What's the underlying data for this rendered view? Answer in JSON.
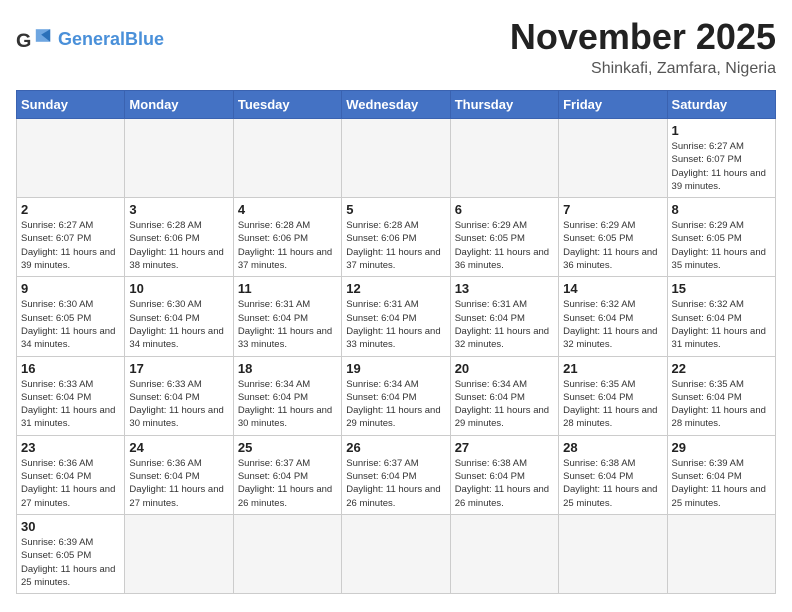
{
  "logo": {
    "general": "General",
    "blue": "Blue"
  },
  "header": {
    "month": "November 2025",
    "location": "Shinkafi, Zamfara, Nigeria"
  },
  "weekdays": [
    "Sunday",
    "Monday",
    "Tuesday",
    "Wednesday",
    "Thursday",
    "Friday",
    "Saturday"
  ],
  "days": {
    "1": {
      "sunrise": "6:27 AM",
      "sunset": "6:07 PM",
      "daylight": "11 hours and 39 minutes."
    },
    "2": {
      "sunrise": "6:27 AM",
      "sunset": "6:07 PM",
      "daylight": "11 hours and 39 minutes."
    },
    "3": {
      "sunrise": "6:28 AM",
      "sunset": "6:06 PM",
      "daylight": "11 hours and 38 minutes."
    },
    "4": {
      "sunrise": "6:28 AM",
      "sunset": "6:06 PM",
      "daylight": "11 hours and 37 minutes."
    },
    "5": {
      "sunrise": "6:28 AM",
      "sunset": "6:06 PM",
      "daylight": "11 hours and 37 minutes."
    },
    "6": {
      "sunrise": "6:29 AM",
      "sunset": "6:05 PM",
      "daylight": "11 hours and 36 minutes."
    },
    "7": {
      "sunrise": "6:29 AM",
      "sunset": "6:05 PM",
      "daylight": "11 hours and 36 minutes."
    },
    "8": {
      "sunrise": "6:29 AM",
      "sunset": "6:05 PM",
      "daylight": "11 hours and 35 minutes."
    },
    "9": {
      "sunrise": "6:30 AM",
      "sunset": "6:05 PM",
      "daylight": "11 hours and 34 minutes."
    },
    "10": {
      "sunrise": "6:30 AM",
      "sunset": "6:04 PM",
      "daylight": "11 hours and 34 minutes."
    },
    "11": {
      "sunrise": "6:31 AM",
      "sunset": "6:04 PM",
      "daylight": "11 hours and 33 minutes."
    },
    "12": {
      "sunrise": "6:31 AM",
      "sunset": "6:04 PM",
      "daylight": "11 hours and 33 minutes."
    },
    "13": {
      "sunrise": "6:31 AM",
      "sunset": "6:04 PM",
      "daylight": "11 hours and 32 minutes."
    },
    "14": {
      "sunrise": "6:32 AM",
      "sunset": "6:04 PM",
      "daylight": "11 hours and 32 minutes."
    },
    "15": {
      "sunrise": "6:32 AM",
      "sunset": "6:04 PM",
      "daylight": "11 hours and 31 minutes."
    },
    "16": {
      "sunrise": "6:33 AM",
      "sunset": "6:04 PM",
      "daylight": "11 hours and 31 minutes."
    },
    "17": {
      "sunrise": "6:33 AM",
      "sunset": "6:04 PM",
      "daylight": "11 hours and 30 minutes."
    },
    "18": {
      "sunrise": "6:34 AM",
      "sunset": "6:04 PM",
      "daylight": "11 hours and 30 minutes."
    },
    "19": {
      "sunrise": "6:34 AM",
      "sunset": "6:04 PM",
      "daylight": "11 hours and 29 minutes."
    },
    "20": {
      "sunrise": "6:34 AM",
      "sunset": "6:04 PM",
      "daylight": "11 hours and 29 minutes."
    },
    "21": {
      "sunrise": "6:35 AM",
      "sunset": "6:04 PM",
      "daylight": "11 hours and 28 minutes."
    },
    "22": {
      "sunrise": "6:35 AM",
      "sunset": "6:04 PM",
      "daylight": "11 hours and 28 minutes."
    },
    "23": {
      "sunrise": "6:36 AM",
      "sunset": "6:04 PM",
      "daylight": "11 hours and 27 minutes."
    },
    "24": {
      "sunrise": "6:36 AM",
      "sunset": "6:04 PM",
      "daylight": "11 hours and 27 minutes."
    },
    "25": {
      "sunrise": "6:37 AM",
      "sunset": "6:04 PM",
      "daylight": "11 hours and 26 minutes."
    },
    "26": {
      "sunrise": "6:37 AM",
      "sunset": "6:04 PM",
      "daylight": "11 hours and 26 minutes."
    },
    "27": {
      "sunrise": "6:38 AM",
      "sunset": "6:04 PM",
      "daylight": "11 hours and 26 minutes."
    },
    "28": {
      "sunrise": "6:38 AM",
      "sunset": "6:04 PM",
      "daylight": "11 hours and 25 minutes."
    },
    "29": {
      "sunrise": "6:39 AM",
      "sunset": "6:04 PM",
      "daylight": "11 hours and 25 minutes."
    },
    "30": {
      "sunrise": "6:39 AM",
      "sunset": "6:05 PM",
      "daylight": "11 hours and 25 minutes."
    }
  }
}
